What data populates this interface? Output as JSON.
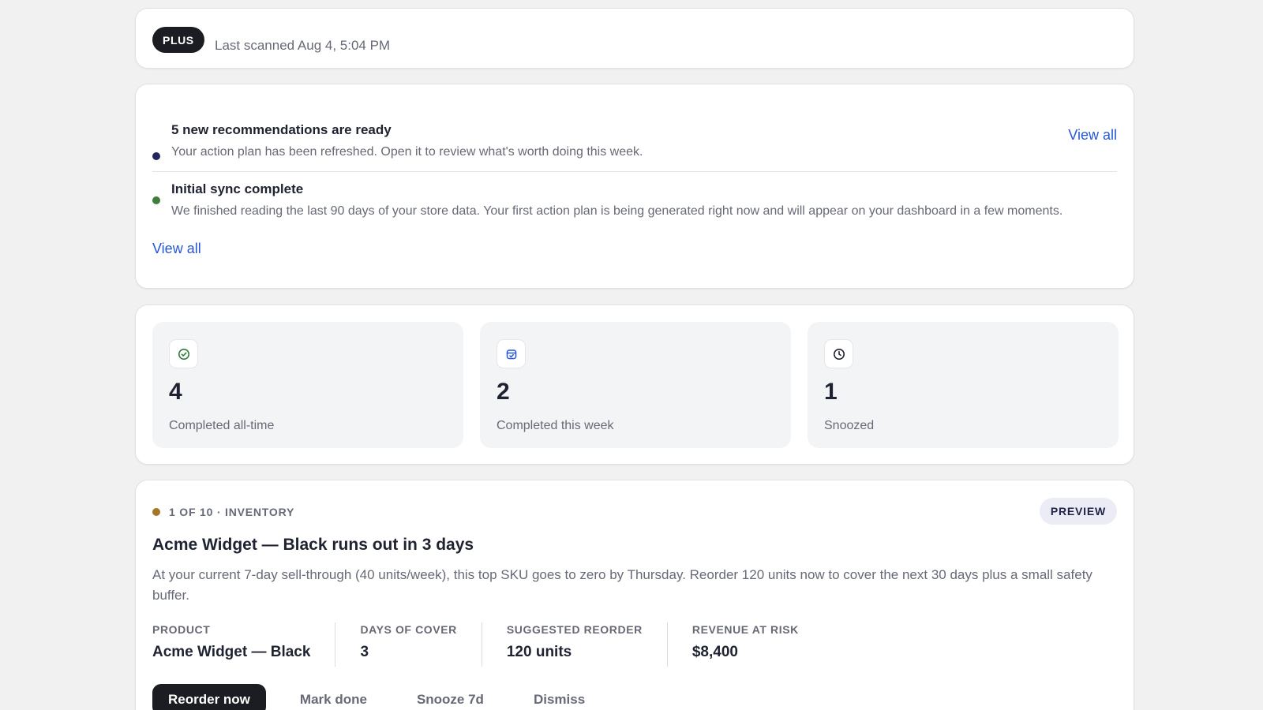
{
  "header": {
    "plan_badge": "PLUS",
    "last_scanned": "Last scanned Aug 4, 5:04 PM"
  },
  "notifications": {
    "items": [
      {
        "title": "5 new recommendations are ready",
        "body": "Your action plan has been refreshed. Open it to review what's worth doing this week.",
        "dot_color": "#24275e",
        "action": "View all"
      },
      {
        "title": "Initial sync complete",
        "body": "We finished reading the last 90 days of your store data. Your first action plan is being generated right now and will appear on your dashboard in a few moments.",
        "dot_color": "#3f7d3a"
      }
    ],
    "footer_link": "View all"
  },
  "stats": [
    {
      "icon": "check-circle-icon",
      "value": "4",
      "label": "Completed all-time",
      "icon_color": "#2f7a3a"
    },
    {
      "icon": "calendar-check-icon",
      "value": "2",
      "label": "Completed this week",
      "icon_color": "#2557d6"
    },
    {
      "icon": "clock-icon",
      "value": "1",
      "label": "Snoozed",
      "icon_color": "#1f2230"
    }
  ],
  "recommendation": {
    "meta": "1 OF 10 · INVENTORY",
    "meta_dot_color": "#a5762a",
    "badge": "PREVIEW",
    "title": "Acme Widget — Black runs out in 3 days",
    "description": "At your current 7-day sell-through (40 units/week), this top SKU goes to zero by Thursday. Reorder 120 units now to cover the next 30 days plus a small safety buffer.",
    "metrics": [
      {
        "label": "PRODUCT",
        "value": "Acme Widget — Black"
      },
      {
        "label": "DAYS OF COVER",
        "value": "3"
      },
      {
        "label": "SUGGESTED REORDER",
        "value": "120 units"
      },
      {
        "label": "REVENUE AT RISK",
        "value": "$8,400"
      }
    ],
    "actions": {
      "primary": "Reorder now",
      "mark_done": "Mark done",
      "snooze": "Snooze 7d",
      "dismiss": "Dismiss"
    }
  }
}
